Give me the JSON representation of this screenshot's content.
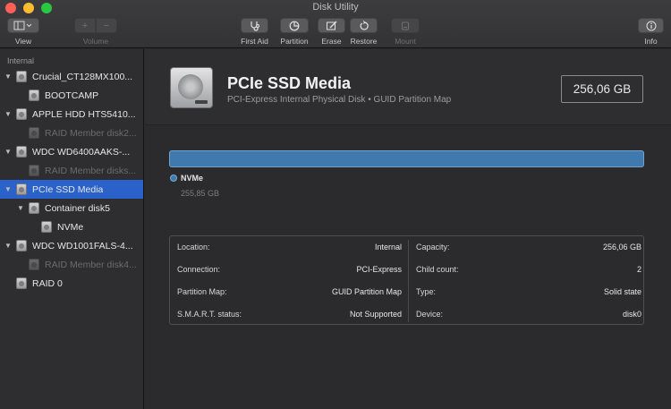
{
  "window": {
    "title": "Disk Utility"
  },
  "toolbar": {
    "view_label": "View",
    "volume_label": "Volume",
    "volume_add": "+",
    "volume_remove": "−",
    "first_aid_label": "First Aid",
    "partition_label": "Partition",
    "erase_label": "Erase",
    "restore_label": "Restore",
    "mount_label": "Mount",
    "info_label": "Info",
    "icons": {
      "view": "sidebar-icon",
      "first_aid": "stethoscope-icon",
      "partition": "pie-icon",
      "erase": "pencil-erase-icon",
      "restore": "restore-arrow-icon",
      "mount": "eject-mount-icon",
      "info": "info-icon"
    }
  },
  "sidebar": {
    "section": "Internal",
    "items": [
      {
        "label": "Crucial_CT128MX100...",
        "level": 0,
        "expanded": true,
        "dim": false,
        "selected": false
      },
      {
        "label": "BOOTCAMP",
        "level": 1,
        "expanded": null,
        "dim": false,
        "selected": false
      },
      {
        "label": "APPLE HDD HTS5410...",
        "level": 0,
        "expanded": true,
        "dim": false,
        "selected": false
      },
      {
        "label": "RAID Member disk2...",
        "level": 1,
        "expanded": null,
        "dim": true,
        "selected": false
      },
      {
        "label": "WDC WD6400AAKS-...",
        "level": 0,
        "expanded": true,
        "dim": false,
        "selected": false
      },
      {
        "label": "RAID Member disks...",
        "level": 1,
        "expanded": null,
        "dim": true,
        "selected": false
      },
      {
        "label": "PCIe SSD Media",
        "level": 0,
        "expanded": true,
        "dim": false,
        "selected": true
      },
      {
        "label": "Container disk5",
        "level": 1,
        "expanded": true,
        "dim": false,
        "selected": false
      },
      {
        "label": "NVMe",
        "level": 2,
        "expanded": null,
        "dim": false,
        "selected": false
      },
      {
        "label": "WDC WD1001FALS-4...",
        "level": 0,
        "expanded": true,
        "dim": false,
        "selected": false
      },
      {
        "label": "RAID Member disk4...",
        "level": 1,
        "expanded": null,
        "dim": true,
        "selected": false
      },
      {
        "label": "RAID 0",
        "level": 0,
        "expanded": null,
        "dim": false,
        "selected": false
      }
    ]
  },
  "disk": {
    "name": "PCIe SSD Media",
    "subtitle": "PCI-Express Internal Physical Disk • GUID Partition Map",
    "capacity": "256,06 GB"
  },
  "usage": {
    "color": "#3f79ad",
    "legend_name": "NVMe",
    "legend_size": "255,85 GB"
  },
  "info": {
    "left": [
      {
        "key": "Location:",
        "value": "Internal"
      },
      {
        "key": "Connection:",
        "value": "PCI-Express"
      },
      {
        "key": "Partition Map:",
        "value": "GUID Partition Map"
      },
      {
        "key": "S.M.A.R.T. status:",
        "value": "Not Supported"
      }
    ],
    "right": [
      {
        "key": "Capacity:",
        "value": "256,06 GB"
      },
      {
        "key": "Child count:",
        "value": "2"
      },
      {
        "key": "Type:",
        "value": "Solid state"
      },
      {
        "key": "Device:",
        "value": "disk0"
      }
    ]
  },
  "colors": {
    "selection": "#2a62c9",
    "accent_bar": "#3f79ad",
    "close": "#fe5f57",
    "minimize": "#febc2e",
    "maximize": "#28c840"
  }
}
